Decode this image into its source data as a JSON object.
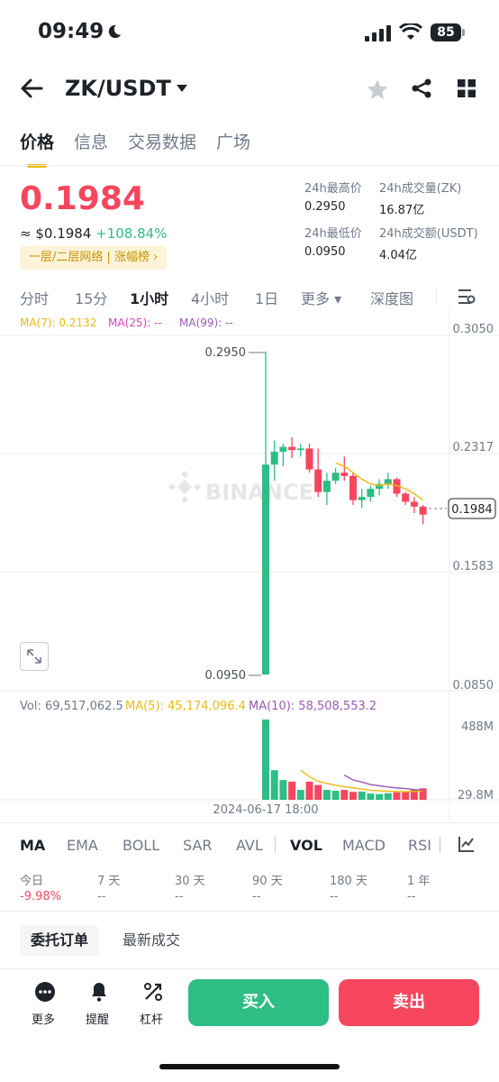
{
  "status_bar": {
    "time": "09:49",
    "battery": "85"
  },
  "header": {
    "pair": "ZK/USDT"
  },
  "tabs": [
    "价格",
    "信息",
    "交易数据",
    "广场"
  ],
  "ticker": {
    "price": "0.1984",
    "approx": "≈ $0.1984",
    "change": "+108.84%",
    "tag": "一层/二层网络 | 涨幅榜 ›",
    "high_label": "24h最高价",
    "high": "0.2950",
    "low_label": "24h最低价",
    "low": "0.0950",
    "vol_label": "24h成交量(ZK)",
    "vol": "16.87亿",
    "amt_label": "24h成交额(USDT)",
    "amt": "4.04亿"
  },
  "timeframes": [
    "分时",
    "15分",
    "1小时",
    "4小时",
    "1日",
    "更多 ▾",
    "深度图"
  ],
  "ma": {
    "ma7": "MA(7): 0.2132",
    "ma25": "MA(25): --",
    "ma99": "MA(99): --"
  },
  "price_axis": [
    "0.3050",
    "0.2317",
    "0.1583",
    "0.0850"
  ],
  "annotations": {
    "high": "0.2950",
    "low": "0.0950",
    "last": "0.1984"
  },
  "watermark": "BINANCE",
  "vol_info": {
    "vol": "Vol: 69,517,062.5",
    "ma5": "MA(5): 45,174,096.4",
    "ma10": "MA(10): 58,508,553.2"
  },
  "vol_axis": [
    "488M",
    "29.8M"
  ],
  "time_label": "2024-06-17 18:00",
  "indicators": [
    "MA",
    "EMA",
    "BOLL",
    "SAR",
    "AVL",
    "VOL",
    "MACD",
    "RSI"
  ],
  "performance": [
    {
      "label": "今日",
      "value": "-9.98%"
    },
    {
      "label": "7 天",
      "value": "--"
    },
    {
      "label": "30 天",
      "value": "--"
    },
    {
      "label": "90 天",
      "value": "--"
    },
    {
      "label": "180 天",
      "value": "--"
    },
    {
      "label": "1 年",
      "value": "--"
    }
  ],
  "order_tabs": [
    "委托订单",
    "最新成交"
  ],
  "bottom": {
    "more": "更多",
    "alert": "提醒",
    "leverage": "杠杆",
    "buy": "买入",
    "sell": "卖出"
  },
  "colors": {
    "up": "#2ebd85",
    "down": "#f6465d",
    "accent": "#f0b90b",
    "ma7": "#f0b90b",
    "ma25": "#e040c0",
    "ma99": "#9b59b6"
  },
  "chart_data": {
    "type": "candlestick",
    "y_range": [
      0.085,
      0.305
    ],
    "candles": [
      {
        "o": 0.095,
        "h": 0.295,
        "l": 0.095,
        "c": 0.225
      },
      {
        "o": 0.225,
        "h": 0.24,
        "l": 0.215,
        "c": 0.233
      },
      {
        "o": 0.233,
        "h": 0.238,
        "l": 0.224,
        "c": 0.236
      },
      {
        "o": 0.236,
        "h": 0.242,
        "l": 0.229,
        "c": 0.234
      },
      {
        "o": 0.234,
        "h": 0.238,
        "l": 0.23,
        "c": 0.235
      },
      {
        "o": 0.235,
        "h": 0.238,
        "l": 0.22,
        "c": 0.222
      },
      {
        "o": 0.222,
        "h": 0.235,
        "l": 0.205,
        "c": 0.208
      },
      {
        "o": 0.208,
        "h": 0.22,
        "l": 0.2,
        "c": 0.215
      },
      {
        "o": 0.215,
        "h": 0.223,
        "l": 0.213,
        "c": 0.22
      },
      {
        "o": 0.22,
        "h": 0.23,
        "l": 0.215,
        "c": 0.218
      },
      {
        "o": 0.218,
        "h": 0.22,
        "l": 0.2,
        "c": 0.203
      },
      {
        "o": 0.203,
        "h": 0.21,
        "l": 0.198,
        "c": 0.205
      },
      {
        "o": 0.205,
        "h": 0.212,
        "l": 0.202,
        "c": 0.21
      },
      {
        "o": 0.21,
        "h": 0.216,
        "l": 0.206,
        "c": 0.213
      },
      {
        "o": 0.213,
        "h": 0.22,
        "l": 0.21,
        "c": 0.216
      },
      {
        "o": 0.216,
        "h": 0.217,
        "l": 0.205,
        "c": 0.207
      },
      {
        "o": 0.207,
        "h": 0.208,
        "l": 0.2,
        "c": 0.202
      },
      {
        "o": 0.202,
        "h": 0.205,
        "l": 0.195,
        "c": 0.199
      },
      {
        "o": 0.199,
        "h": 0.2,
        "l": 0.188,
        "c": 0.194
      }
    ],
    "ma7": [
      null,
      null,
      null,
      null,
      null,
      null,
      null,
      null,
      0.226,
      0.224,
      0.22,
      0.216,
      0.213,
      0.212,
      0.213,
      0.212,
      0.21,
      0.207,
      0.203
    ],
    "volumes": [
      488,
      180,
      120,
      110,
      60,
      110,
      90,
      60,
      55,
      60,
      48,
      50,
      38,
      35,
      40,
      45,
      50,
      60,
      69.5
    ],
    "vol_ma5": [
      null,
      null,
      null,
      null,
      180,
      140,
      112,
      100,
      88,
      80,
      72,
      66,
      58,
      55,
      52,
      50,
      49,
      51,
      55
    ],
    "vol_ma10": [
      null,
      null,
      null,
      null,
      null,
      null,
      null,
      null,
      null,
      150,
      120,
      108,
      92,
      85,
      78,
      72,
      68,
      62,
      58.5
    ],
    "vol_range": [
      0,
      488
    ]
  }
}
